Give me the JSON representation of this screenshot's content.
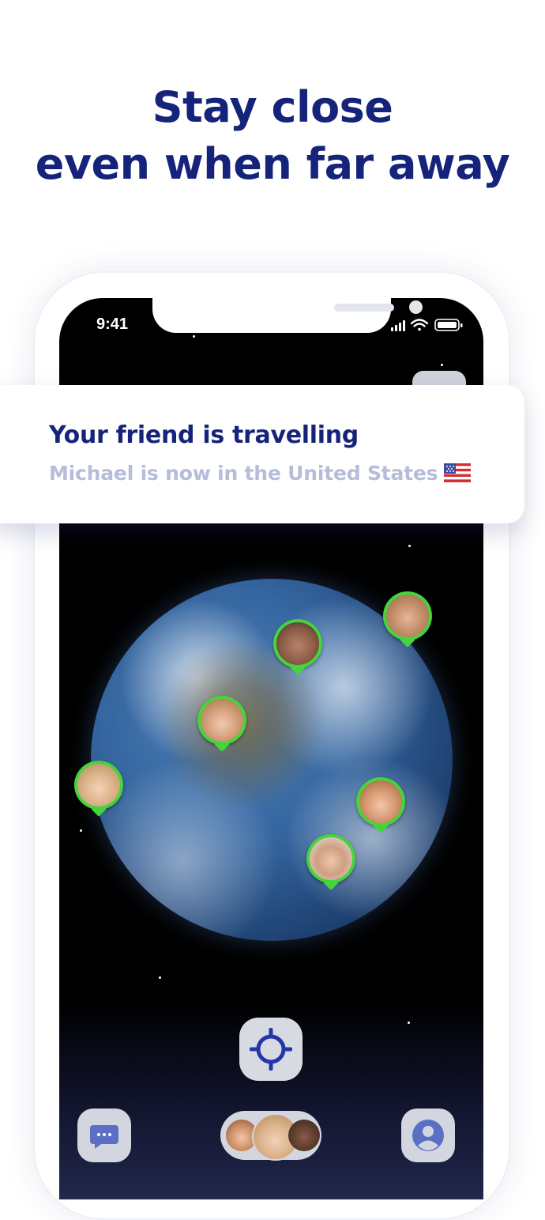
{
  "headline": {
    "line1": "Stay close",
    "line2": "even when far away"
  },
  "status_bar": {
    "time": "9:41"
  },
  "notification": {
    "title": "Your friend is travelling",
    "body": "Michael is now in the United States"
  },
  "colors": {
    "brand_navy": "#16237a",
    "pin_green": "#46d43c",
    "muted_text": "#b6bcda"
  },
  "icons": [
    "signal-icon",
    "wifi-icon",
    "battery-icon",
    "crosshair-icon",
    "chat-icon",
    "profile-icon",
    "us-flag-icon"
  ]
}
